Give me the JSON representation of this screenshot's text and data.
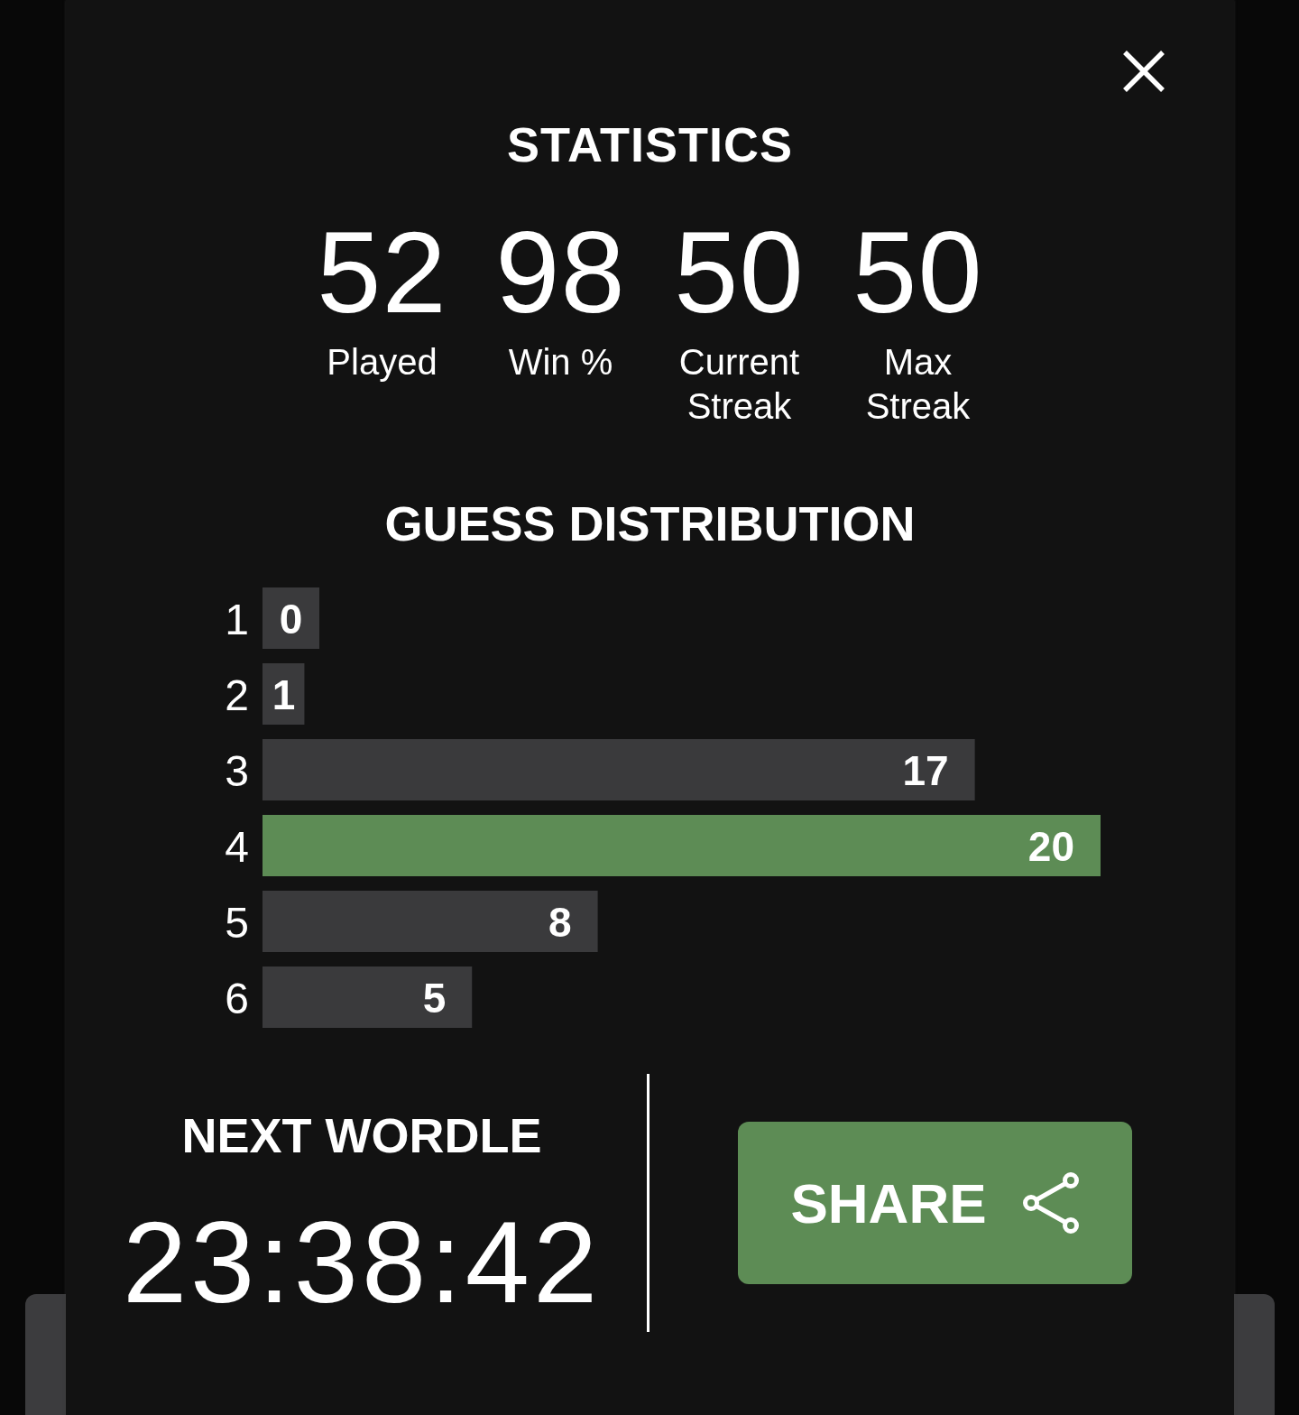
{
  "statistics": {
    "title": "STATISTICS",
    "stats": [
      {
        "value": "52",
        "label": "Played"
      },
      {
        "value": "98",
        "label": "Win %"
      },
      {
        "value": "50",
        "label": "Current Streak"
      },
      {
        "value": "50",
        "label": "Max Streak"
      }
    ]
  },
  "guess_distribution": {
    "title": "GUESS DISTRIBUTION",
    "chart_data": {
      "type": "bar",
      "orientation": "horizontal",
      "categories": [
        "1",
        "2",
        "3",
        "4",
        "5",
        "6"
      ],
      "stacked": true,
      "data_labels": true,
      "series": [
        {
          "color": "#3a3a3c",
          "values": [
            0,
            1,
            17,
            null,
            8,
            5
          ]
        },
        {
          "color": "#5d8c55",
          "values": [
            null,
            null,
            null,
            20,
            null,
            null
          ]
        }
      ]
    }
  },
  "next_wordle": {
    "title": "NEXT WORDLE",
    "countdown": "23:38:42"
  },
  "share_button": {
    "label": "SHARE"
  }
}
